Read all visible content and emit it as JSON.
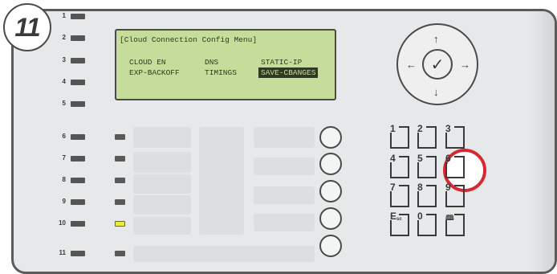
{
  "step_badge": "11",
  "row_numbers": [
    "1",
    "2",
    "3",
    "4",
    "5",
    "6",
    "7",
    "8",
    "9",
    "10",
    "11"
  ],
  "lcd": {
    "title": "[Cloud Connection Config Menu]",
    "options": [
      "CLOUD EN",
      "DNS",
      "STATIC-IP",
      "EXP-BACKOFF",
      "TIMINGS",
      "SAVE-CBANGES"
    ],
    "selected": "SAVE-CBANGES"
  },
  "nav": {
    "ok_icon": "check-icon",
    "up": "↑",
    "down": "↓",
    "left": "←",
    "right": "→",
    "ok": "✓"
  },
  "keypad": {
    "keys": [
      "1",
      "2",
      "3",
      "4",
      "5",
      "6",
      "7",
      "8",
      "9",
      "E",
      "0",
      ""
    ],
    "esc_sub": "sc",
    "book_icon": "book-icon",
    "highlighted_key": "6"
  },
  "colors": {
    "lcd_bg": "#c6dc9a",
    "highlight": "#d42a33",
    "led_yellow": "#e8ea3c"
  }
}
